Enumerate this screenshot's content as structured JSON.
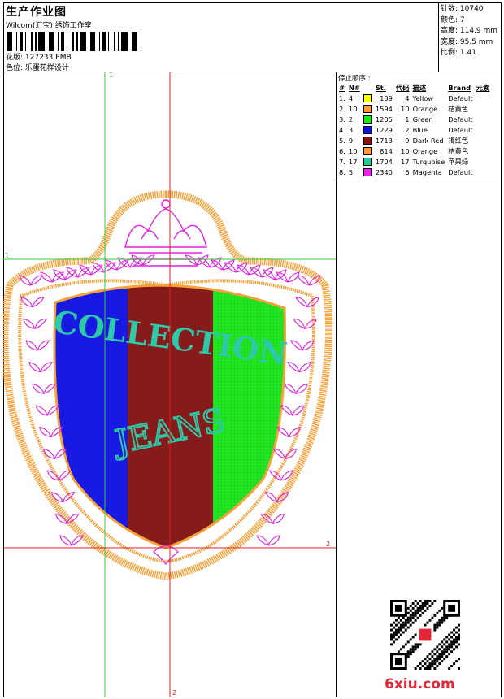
{
  "header": {
    "title": "生产作业图",
    "company": "Wilcom(汇宝) 绣饰工作室",
    "design_file": "花版: 127233.EMB",
    "placement": "色位: 乐蛋花样设计"
  },
  "stats": {
    "stitches": "针数: 10740",
    "colors": "颜色: 7",
    "height": "高度: 114.9 mm",
    "width": "宽度: 95.5 mm",
    "scale": "比例: 1.41"
  },
  "stop_sequence": {
    "title": "停止顺序 :",
    "headers": [
      "#",
      "N#",
      "St.",
      "代码",
      "描述",
      "Brand",
      "元素"
    ],
    "rows": [
      {
        "idx": "1.",
        "n": "4",
        "color": "#ffff00",
        "st": "139",
        "code": "4",
        "desc": "Yellow",
        "brand": "Default"
      },
      {
        "idx": "2.",
        "n": "10",
        "color": "#ff9933",
        "st": "1594",
        "code": "10",
        "desc": "Orange",
        "brand": "桔黄色"
      },
      {
        "idx": "3.",
        "n": "2",
        "color": "#11ee11",
        "st": "1205",
        "code": "1",
        "desc": "Green",
        "brand": "Default"
      },
      {
        "idx": "4.",
        "n": "3",
        "color": "#1010ee",
        "st": "1229",
        "code": "2",
        "desc": "Blue",
        "brand": "Default"
      },
      {
        "idx": "5.",
        "n": "9",
        "color": "#8b1010",
        "st": "1713",
        "code": "9",
        "desc": "Dark Red",
        "brand": "褐红色"
      },
      {
        "idx": "6.",
        "n": "10",
        "color": "#ff9933",
        "st": "814",
        "code": "10",
        "desc": "Orange",
        "brand": "桔黄色"
      },
      {
        "idx": "7.",
        "n": "17",
        "color": "#22cc99",
        "st": "1704",
        "code": "17",
        "desc": "Turquoise",
        "brand": "苹果绿"
      },
      {
        "idx": "8.",
        "n": "5",
        "color": "#ee22ee",
        "st": "2340",
        "code": "6",
        "desc": "Magenta",
        "brand": "Default"
      }
    ]
  },
  "design": {
    "text_top": "COLLECTION",
    "text_bottom": "JEANS",
    "guide_markers": [
      "1",
      "1",
      "2",
      "2"
    ]
  },
  "colors": {
    "orange": "#f7a13a",
    "magenta": "#e020e0",
    "blue": "#1a1ae8",
    "dark_red": "#8a1b1b",
    "green": "#22e622",
    "turquoise": "#2ec9a8",
    "guide_green": "#33cc33",
    "guide_red": "#dd2222"
  },
  "watermark": "6xiu.com"
}
